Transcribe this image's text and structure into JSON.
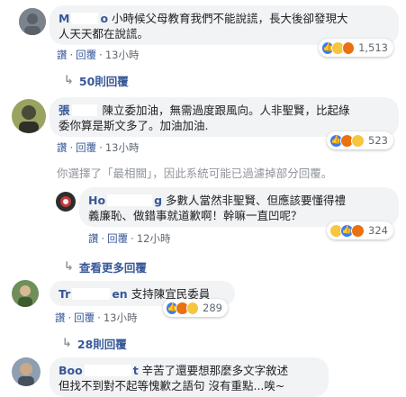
{
  "comments": [
    {
      "author": "M",
      "author_tail": "o",
      "text_lines": [
        "小時候父母教育我們不能說謊，長大後卻發現大",
        "人天天都在說謊。"
      ],
      "actions": {
        "like": "讚",
        "reply": "回覆",
        "time": "13小時"
      },
      "reaction_count": "1,513",
      "more_replies": "50則回覆"
    },
    {
      "author": "張",
      "text_lines": [
        "陳立委加油，無需過度跟風向。人非聖賢，比起綠",
        "委你算是斯文多了。加油加油."
      ],
      "actions": {
        "like": "讚",
        "reply": "回覆",
        "time": "13小時"
      },
      "reaction_count": "523",
      "filter_note": "你選擇了「最相關」，因此系統可能已過濾掉部分回覆。"
    },
    {
      "author": "Ho",
      "author_tail": "g",
      "text_lines": [
        "多數人當然非聖賢、但應該要懂得禮",
        "義廉恥、做錯事就道歉啊！幹嘛一直凹呢？"
      ],
      "actions": {
        "like": "讚",
        "reply": "回覆",
        "time": "12小時"
      },
      "reaction_count": "324",
      "more_replies": "查看更多回覆"
    },
    {
      "author": "Tr",
      "author_tail": "en",
      "text_lines": [
        "支持陳宜民委員"
      ],
      "actions": {
        "like": "讚",
        "reply": "回覆",
        "time": "13小時"
      },
      "reaction_count": "289",
      "more_replies": "28則回覆"
    },
    {
      "author": "Boo",
      "author_tail": "t",
      "text_lines": [
        "辛苦了還要想那麼多文字敘述",
        "但找不到對不起等愧歉之語句 沒有重點...唉~"
      ]
    }
  ],
  "colors": {
    "link": "#385898",
    "bubble": "#f2f3f5",
    "meta": "#606770",
    "like": "#3b7cf0",
    "haha": "#f7c540",
    "angry": "#e9710f"
  }
}
